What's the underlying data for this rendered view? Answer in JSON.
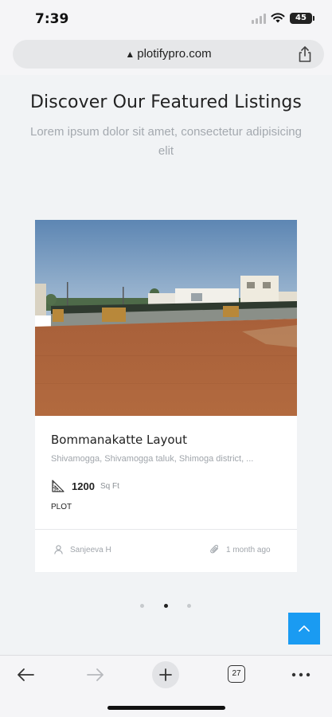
{
  "status_bar": {
    "time": "7:39",
    "battery": "45"
  },
  "browser": {
    "url": "plotifypro.com",
    "url_warning_icon": "warning-triangle-icon",
    "share_icon": "share-icon",
    "tab_count": "27"
  },
  "section": {
    "title": "Discover Our Featured Listings",
    "subtitle": "Lorem ipsum dolor sit amet, consectetur adipisicing elit"
  },
  "listing": {
    "title": "Bommanakatte Layout",
    "address": "Shivamogga, Shivamogga taluk, Shimoga district, ...",
    "area_value": "1200",
    "area_unit": "Sq Ft",
    "type": "PLOT",
    "agent": "Sanjeeva H",
    "posted": "1 month ago"
  },
  "carousel": {
    "total": 3,
    "active_index": 1
  },
  "colors": {
    "accent": "#1a9bf2",
    "page_bg": "#f1f3f5",
    "muted_text": "#a0a5ab"
  }
}
